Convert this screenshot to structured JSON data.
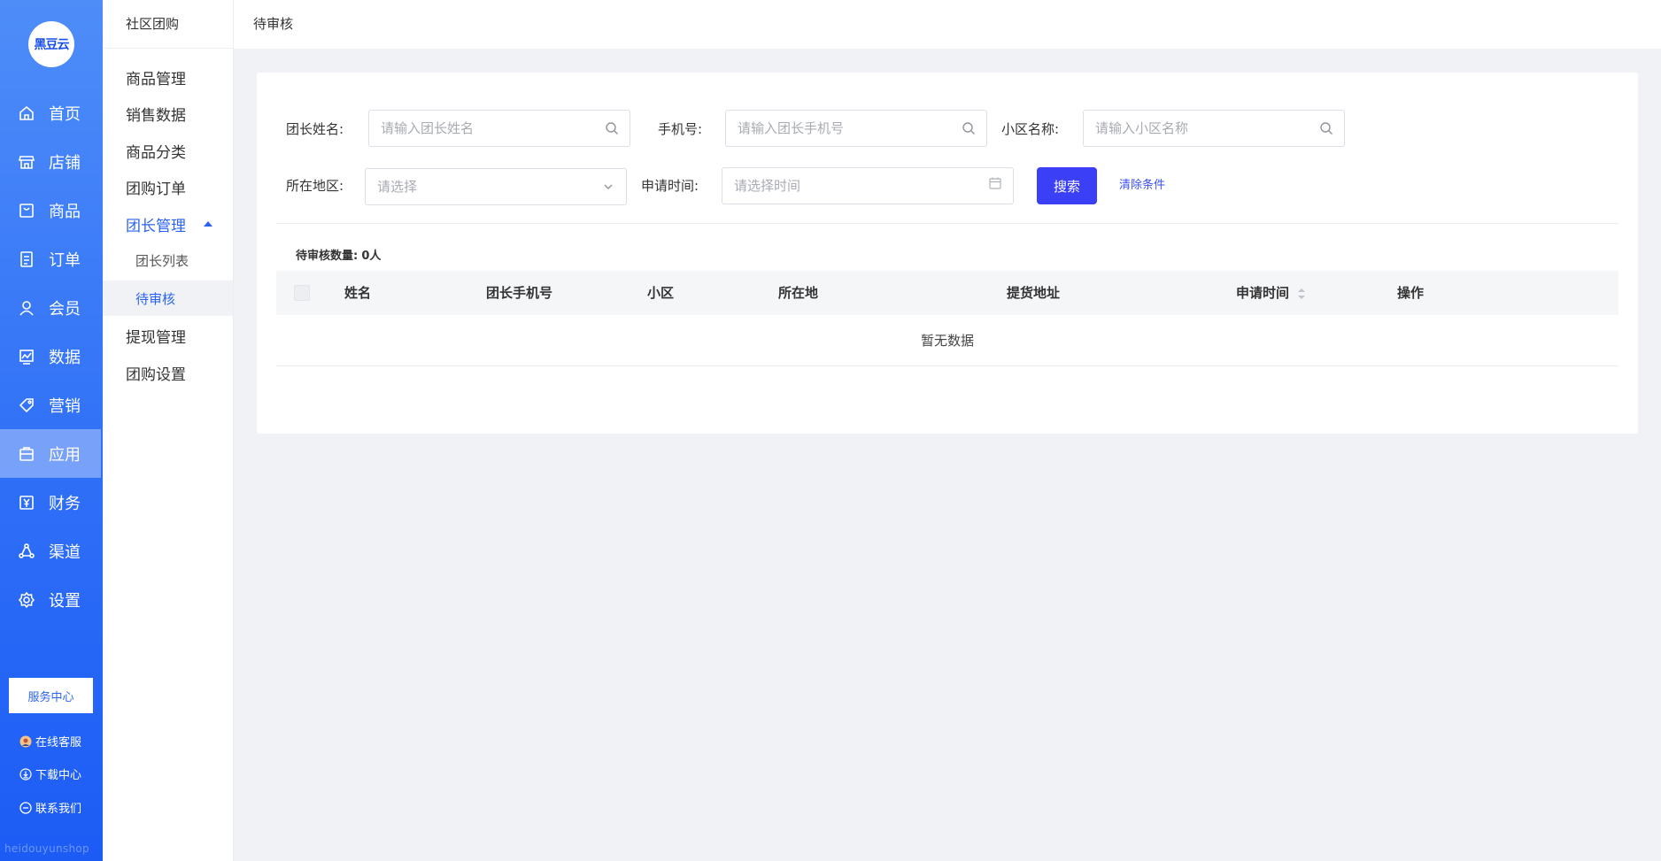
{
  "nav": {
    "logo_text": "黑豆云",
    "items": [
      {
        "label": "首页",
        "icon": "home-icon"
      },
      {
        "label": "店铺",
        "icon": "store-icon"
      },
      {
        "label": "商品",
        "icon": "goods-icon"
      },
      {
        "label": "订单",
        "icon": "order-icon"
      },
      {
        "label": "会员",
        "icon": "member-icon"
      },
      {
        "label": "数据",
        "icon": "data-icon"
      },
      {
        "label": "营销",
        "icon": "tag-icon"
      },
      {
        "label": "应用",
        "icon": "app-icon",
        "active": true
      },
      {
        "label": "财务",
        "icon": "finance-icon"
      },
      {
        "label": "渠道",
        "icon": "channel-icon"
      },
      {
        "label": "设置",
        "icon": "gear-icon"
      }
    ],
    "service_center": "服务中心",
    "online_service": "在线客服",
    "download_center": "下载中心",
    "contact_us": "联系我们",
    "watermark": "heidouyunshop"
  },
  "submenu": {
    "title": "社区团购",
    "items": [
      "商品管理",
      "销售数据",
      "商品分类",
      "团购订单",
      "团长管理"
    ],
    "children": [
      "团长列表",
      "待审核"
    ],
    "items_after": [
      "提现管理",
      "团购设置"
    ]
  },
  "topbar": {
    "title": "待审核"
  },
  "filters": {
    "leader_name_label": "团长姓名:",
    "leader_name_placeholder": "请输入团长姓名",
    "phone_label": "手机号:",
    "phone_placeholder": "请输入团长手机号",
    "community_label": "小区名称:",
    "community_placeholder": "请输入小区名称",
    "region_label": "所在地区:",
    "region_placeholder": "请选择",
    "apply_time_label": "申请时间:",
    "apply_time_placeholder": "请选择时间",
    "search_button": "搜索",
    "clear_link": "清除条件"
  },
  "summary": {
    "label": "待审核数量:",
    "value": "0人"
  },
  "table": {
    "columns": [
      "姓名",
      "团长手机号",
      "小区",
      "所在地",
      "提货地址",
      "申请时间",
      "操作"
    ],
    "empty_text": "暂无数据"
  }
}
